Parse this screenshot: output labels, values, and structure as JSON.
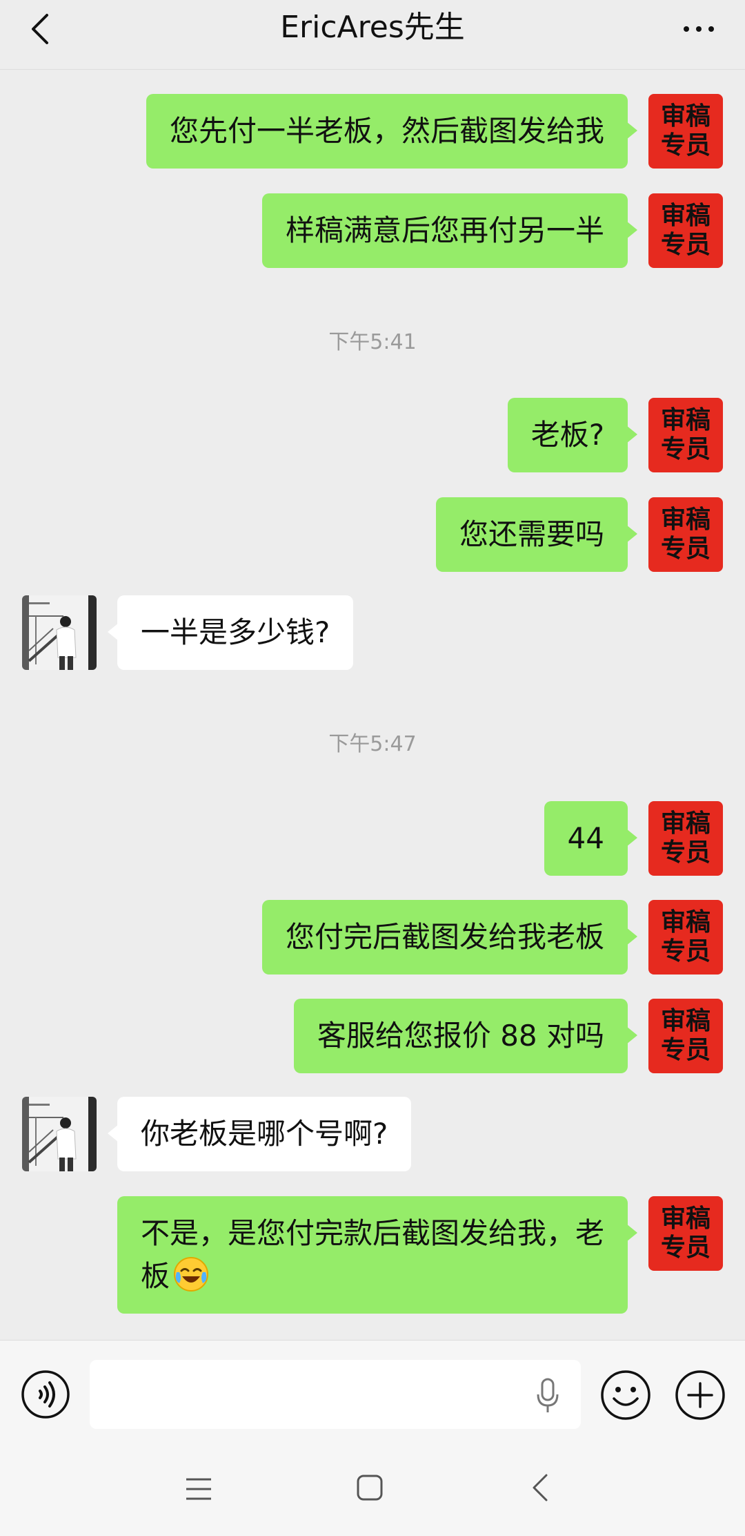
{
  "header": {
    "title": "EricAres先生"
  },
  "sender_avatar": {
    "line1": "审稿",
    "line2": "专员",
    "color": "#e62a1f"
  },
  "messages": [
    {
      "type": "out",
      "text": "您先付一半老板，然后截图发给我"
    },
    {
      "type": "out",
      "text": "样稿满意后您再付另一半"
    },
    {
      "type": "time",
      "text": "下午5:41"
    },
    {
      "type": "out",
      "text": "老板?"
    },
    {
      "type": "out",
      "text": "您还需要吗"
    },
    {
      "type": "in",
      "text": "一半是多少钱?"
    },
    {
      "type": "time",
      "text": "下午5:47"
    },
    {
      "type": "out",
      "text": "44"
    },
    {
      "type": "out",
      "text": "您付完后截图发给我老板"
    },
    {
      "type": "out",
      "text": "客服给您报价 88 对吗"
    },
    {
      "type": "in",
      "text": "你老板是哪个号啊?"
    },
    {
      "type": "out",
      "text": "不是，是您付完款后截图发给我，老板",
      "emoji": "face-with-tears-of-joy-icon"
    }
  ],
  "input": {
    "value": "",
    "placeholder": ""
  },
  "colors": {
    "outgoing_bubble": "#95ec69",
    "incoming_bubble": "#ffffff",
    "background": "#ededed"
  },
  "icons": {
    "back": "chevron-left-icon",
    "more": "more-dots-icon",
    "voice": "voice-icon",
    "mic": "microphone-icon",
    "emoji": "smiley-icon",
    "plus": "plus-icon",
    "nav_menu": "menu-lines-icon",
    "nav_home": "home-square-icon",
    "nav_back": "nav-back-icon"
  }
}
